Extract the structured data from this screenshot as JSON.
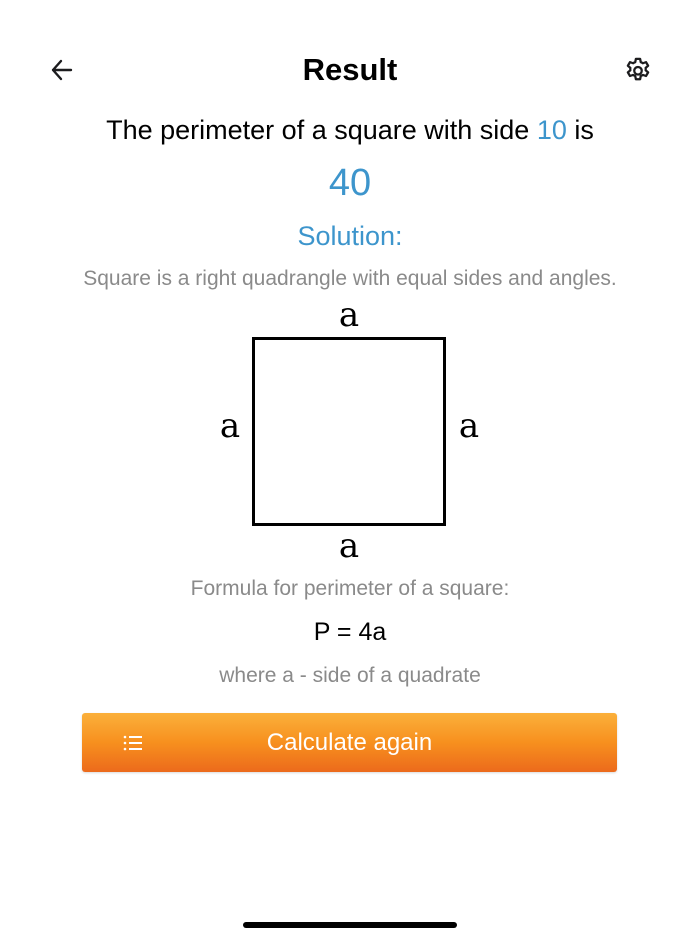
{
  "header": {
    "title": "Result",
    "back_icon": "arrow-left-icon",
    "settings_icon": "gear-icon"
  },
  "result": {
    "sentence_prefix": "The perimeter of a square with side ",
    "side_value": "10",
    "sentence_suffix": " is",
    "value": "40"
  },
  "solution": {
    "label": "Solution:",
    "definition": "Square is a right quadrangle with equal sides and angles.",
    "diagram": {
      "side_label_top": "a",
      "side_label_left": "a",
      "side_label_right": "a",
      "side_label_bottom": "a"
    },
    "formula_label": "Formula for perimeter of a square:",
    "formula": "P = 4a",
    "formula_note": "where a - side of a quadrate"
  },
  "actions": {
    "calculate_again_label": "Calculate again",
    "calculate_again_icon": "list-icon"
  },
  "colors": {
    "accent": "#3d95cc",
    "muted_text": "#8a8a8a",
    "button_gradient_top": "#fbb03b",
    "button_gradient_bottom": "#ec6a1c"
  }
}
